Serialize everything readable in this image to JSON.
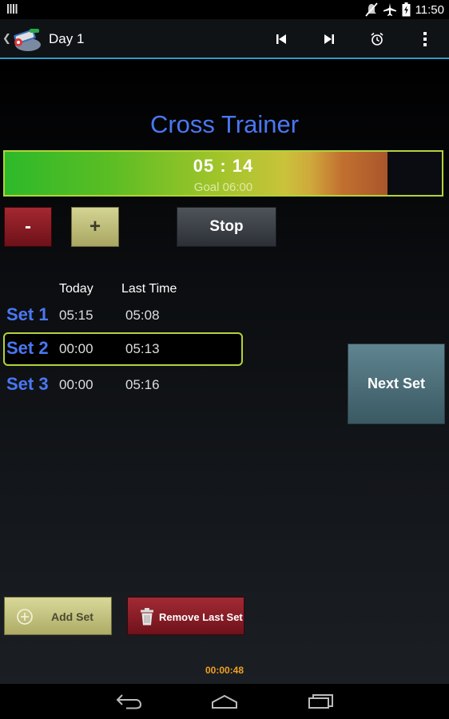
{
  "status_bar": {
    "time": "11:50",
    "icons": [
      "notification-icon",
      "mute-icon",
      "airplane-mode-icon",
      "battery-charging-icon"
    ]
  },
  "action_bar": {
    "title": "Day 1",
    "actions": [
      "skip-previous-icon",
      "skip-next-icon",
      "alarm-icon",
      "overflow-menu-icon"
    ]
  },
  "exercise": {
    "title": "Cross Trainer"
  },
  "timer": {
    "time": "05 : 14",
    "goal": "Goal 06:00",
    "progress": 0.875
  },
  "controls": {
    "minus_label": "-",
    "plus_label": "+",
    "stop_label": "Stop"
  },
  "sets_table": {
    "headers": {
      "today": "Today",
      "last_time": "Last Time"
    },
    "rows": [
      {
        "label": "Set 1",
        "today": "05:15",
        "last_time": "05:08"
      },
      {
        "label": "Set 2",
        "today": "00:00",
        "last_time": "05:13"
      },
      {
        "label": "Set 3",
        "today": "00:00",
        "last_time": "05:16"
      }
    ],
    "selected_row": 1
  },
  "next_set_label": "Next Set",
  "footer_buttons": {
    "add_set_label": "Add Set",
    "remove_last_set_label": "Remove Last Set"
  },
  "elapsed_time": "00:00:48",
  "colors": {
    "accent_blue": "#4a77f3",
    "highlight_green": "#b2d33a",
    "elapsed_orange": "#f0a020",
    "holo_blue": "#33b5e5"
  },
  "nav_bar": {
    "buttons": [
      "back-icon",
      "home-icon",
      "recent-apps-icon"
    ]
  }
}
